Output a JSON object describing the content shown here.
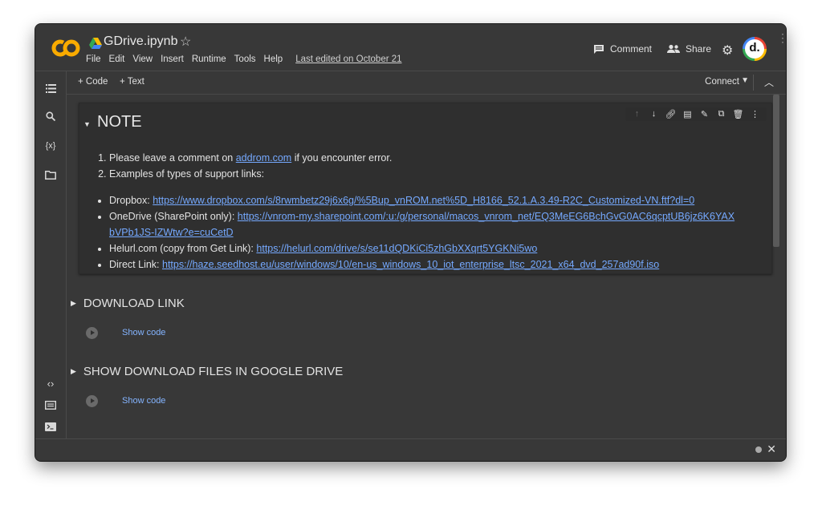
{
  "app": {
    "notebook_title": "GDrive.ipynb",
    "menu": [
      "File",
      "Edit",
      "View",
      "Insert",
      "Runtime",
      "Tools",
      "Help"
    ],
    "last_edited": "Last edited on October 21",
    "comment_label": "Comment",
    "share_label": "Share",
    "avatar_letter": "d."
  },
  "toolbar": {
    "add_code": "+ Code",
    "add_text": "+ Text",
    "connect": "Connect"
  },
  "note_cell": {
    "heading": "NOTE",
    "item1_pre": "Please leave a comment on ",
    "item1_link": "addrom.com",
    "item1_post": " if you encounter error.",
    "item2": "Examples of types of support links:",
    "links": [
      {
        "label": "Dropbox: ",
        "url": "https://www.dropbox.com/s/8rwmbetz29j6x6g/%5Bup_vnROM.net%5D_H8166_52.1.A.3.49-R2C_Customized-VN.ftf?dl=0"
      },
      {
        "label": "OneDrive (SharePoint only): ",
        "url": "https://vnrom-my.sharepoint.com/:u:/g/personal/macos_vnrom_net/EQ3MeEG6BchGvG0AC6qcptUB6jz6K6YAXbVPb1JS-IZWtw?e=cuCetD"
      },
      {
        "label": "Helurl.com (copy from Get Link): ",
        "url": "https://helurl.com/drive/s/se11dQDKiCi5zhGbXXqrt5YGKNi5wo"
      },
      {
        "label": "Direct Link: ",
        "url": "https://haze.seedhost.eu/user/windows/10/en-us_windows_10_iot_enterprise_ltsc_2021_x64_dvd_257ad90f.iso"
      }
    ]
  },
  "sections": [
    {
      "title": "DOWNLOAD LINK",
      "show_code": "Show code"
    },
    {
      "title": "SHOW DOWNLOAD FILES IN GOOGLE DRIVE",
      "show_code": "Show code"
    }
  ],
  "colors": {
    "background": "#383838",
    "cell_background": "#2f2f2f",
    "link": "#75a9ff",
    "logo_orange": "#f9ab00"
  }
}
